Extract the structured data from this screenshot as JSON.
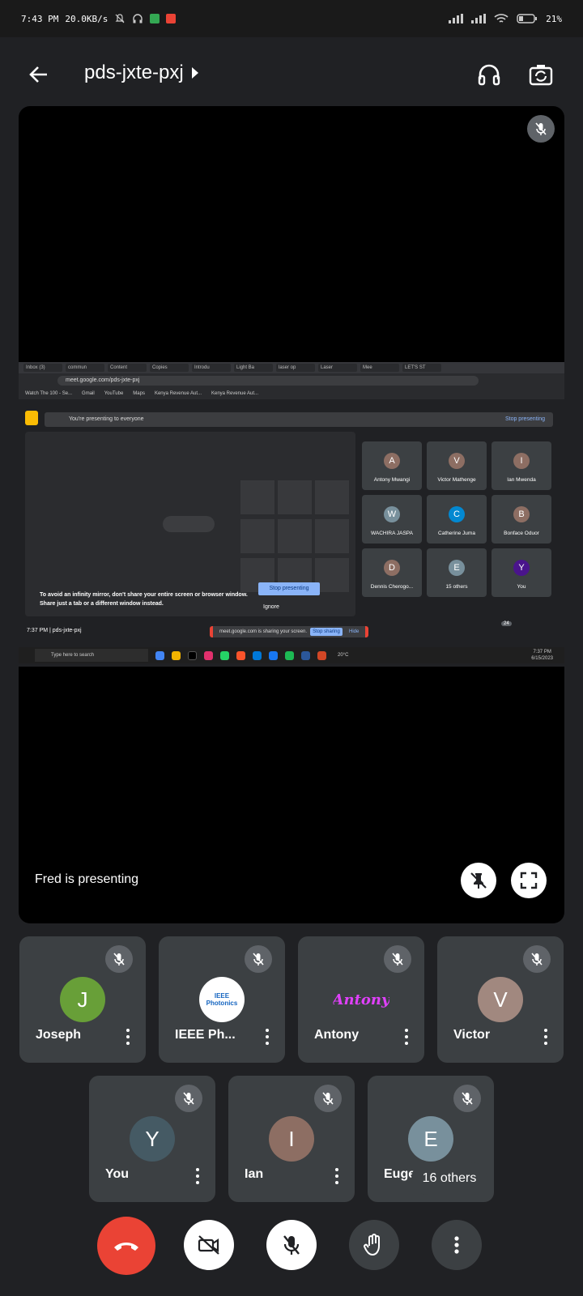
{
  "status_bar": {
    "time": "7:43 PM",
    "net_speed": "20.0KB/s",
    "battery": "21%"
  },
  "header": {
    "meeting_code": "pds-jxte-pxj",
    "icons": [
      "back-arrow-icon",
      "headphones-icon",
      "switch-camera-icon"
    ]
  },
  "stage": {
    "presenter_label": "Fred is presenting",
    "shared_screen": {
      "tabs": [
        "Inbox (3)",
        "commun",
        "Content",
        "Copies",
        "Introdu",
        "Light Ba",
        "laser op",
        "Laser",
        "Mee",
        "LET'S ST"
      ],
      "url": "meet.google.com/pds-jxte-pxj",
      "bookmarks": [
        "Watch The 100 - Se...",
        "Gmail",
        "YouTube",
        "Maps",
        "Kenya Revenue Aut...",
        "Kenya Revenue Aut..."
      ],
      "presenting_banner": "You're presenting to everyone",
      "stop_presenting_link": "Stop presenting",
      "mirror_warning_line1": "To avoid an infinity mirror, don't share your entire screen or browser window.",
      "mirror_warning_line2": "Share just a tab or a different window instead.",
      "stop_presenting_button": "Stop presenting",
      "ignore_label": "Ignore",
      "footer_time_code": "7:37 PM  |  pds-jxte-pxj",
      "sharing_notice": "meet.google.com is sharing your screen.",
      "stop_sharing": "Stop sharing",
      "hide": "Hide",
      "participant_count_badge": "24",
      "taskbar_search": "Type here to search",
      "taskbar_weather": "20°C",
      "taskbar_time": "7:37 PM",
      "taskbar_date": "6/15/2023",
      "grid": [
        {
          "name": "Antony Mwangi",
          "initial": "A",
          "color": "#6a4c93"
        },
        {
          "name": "Victor Mathenge",
          "initial": "V",
          "color": "#8d6e63"
        },
        {
          "name": "Ian Mwenda",
          "initial": "I",
          "color": "#795548"
        },
        {
          "name": "WACHIRA JASPA",
          "initial": "W",
          "color": "#78909c"
        },
        {
          "name": "Catherine Juma",
          "initial": "C",
          "color": "#0288d1"
        },
        {
          "name": "Bonface Oduor",
          "initial": "B",
          "color": "#37474f"
        },
        {
          "name": "Dennis Cherogo...",
          "initial": "D",
          "color": "#5d4037"
        },
        {
          "name": "15 others",
          "initial": "E",
          "color": "#78909c"
        },
        {
          "name": "You",
          "initial": "Y",
          "color": "#4a148c"
        }
      ]
    }
  },
  "participants": [
    {
      "name": "Joseph",
      "initial": "J",
      "avatar_color": "#689f38"
    },
    {
      "name": "IEEE Ph...",
      "initial": "IEEE Photonics",
      "avatar_color": "#ffffff"
    },
    {
      "name": "Antony",
      "initial": "Antony",
      "avatar_color": "#3c4043"
    },
    {
      "name": "Victor",
      "initial": "V",
      "avatar_color": "#a1887f"
    },
    {
      "name": "You",
      "initial": "Y",
      "avatar_color": "#455a64"
    },
    {
      "name": "Ian",
      "initial": "I",
      "avatar_color": "#8d6e63"
    },
    {
      "name": "Eugen",
      "initial": "E",
      "avatar_color": "#78909c"
    }
  ],
  "others_pill": "16 others",
  "controls": [
    "end-call-icon",
    "camera-off-icon",
    "mic-off-icon",
    "raise-hand-icon",
    "more-options-icon"
  ],
  "colors": {
    "background": "#202124",
    "tile": "#3c4043",
    "end_call": "#ea4335",
    "accent_blue": "#8ab4f8"
  }
}
